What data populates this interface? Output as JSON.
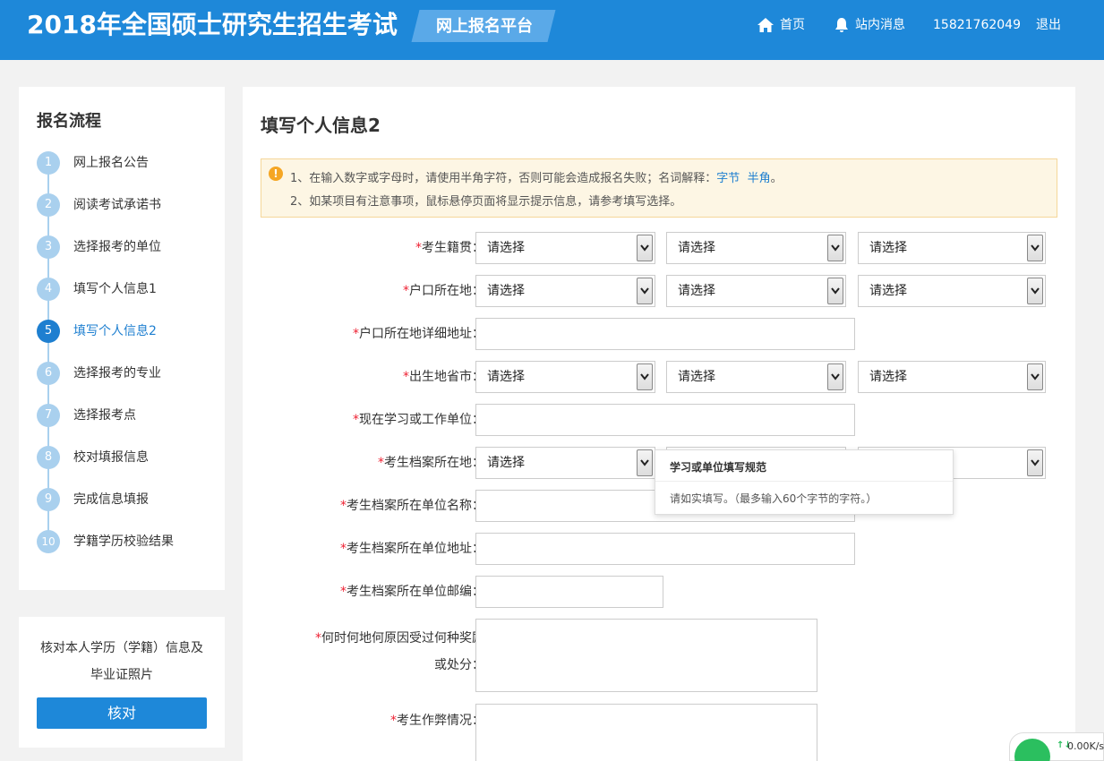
{
  "header": {
    "title": "2018年全国硕士研究生招生考试",
    "badge": "网上报名平台",
    "nav": {
      "home": "首页",
      "messages": "站内消息",
      "phone": "15821762049",
      "logout": "退出"
    }
  },
  "sidebar": {
    "title": "报名流程",
    "steps": [
      {
        "num": "1",
        "label": "网上报名公告"
      },
      {
        "num": "2",
        "label": "阅读考试承诺书"
      },
      {
        "num": "3",
        "label": "选择报考的单位"
      },
      {
        "num": "4",
        "label": "填写个人信息1"
      },
      {
        "num": "5",
        "label": "填写个人信息2"
      },
      {
        "num": "6",
        "label": "选择报考的专业"
      },
      {
        "num": "7",
        "label": "选择报考点"
      },
      {
        "num": "8",
        "label": "校对填报信息"
      },
      {
        "num": "9",
        "label": "完成信息填报"
      },
      {
        "num": "10",
        "label": "学籍学历校验结果"
      }
    ],
    "verify_text_1": "核对本人学历（学籍）信息及",
    "verify_text_2": "毕业证照片",
    "verify_button": "核对"
  },
  "main": {
    "page_title": "填写个人信息2",
    "notice": {
      "line1_prefix": "1、在输入数字或字母时，请使用半角字符，否则可能会造成报名失败；名词解释：",
      "link1": "字节",
      "link2": "半角",
      "line1_suffix": "。",
      "line2": "2、如某项目有注意事项，鼠标悬停页面将显示提示信息，请参考填写选择。"
    },
    "required_mark": "*",
    "select_placeholder": "请选择",
    "fields": {
      "native_place": "考生籍贯：",
      "hukou_location": "户口所在地：",
      "hukou_address": "户口所在地详细地址：",
      "birthplace": "出生地省市：",
      "current_unit": "现在学习或工作单位：",
      "archive_location": "考生档案所在地：",
      "archive_unit_name": "考生档案所在单位名称：",
      "archive_unit_address": "考生档案所在单位地址：",
      "archive_unit_zip": "考生档案所在单位邮编：",
      "rewards_line1": "何时何地何原因受过何种奖励",
      "rewards_line2": "或处分：",
      "cheating": "考生作弊情况："
    },
    "tooltip": {
      "title": "学习或单位填写规范",
      "body": "请如实填写。（最多输入60个字节的字符。）"
    }
  },
  "tray": {
    "rate_icon": "↑↓",
    "net_rate": "0.00K/s"
  }
}
